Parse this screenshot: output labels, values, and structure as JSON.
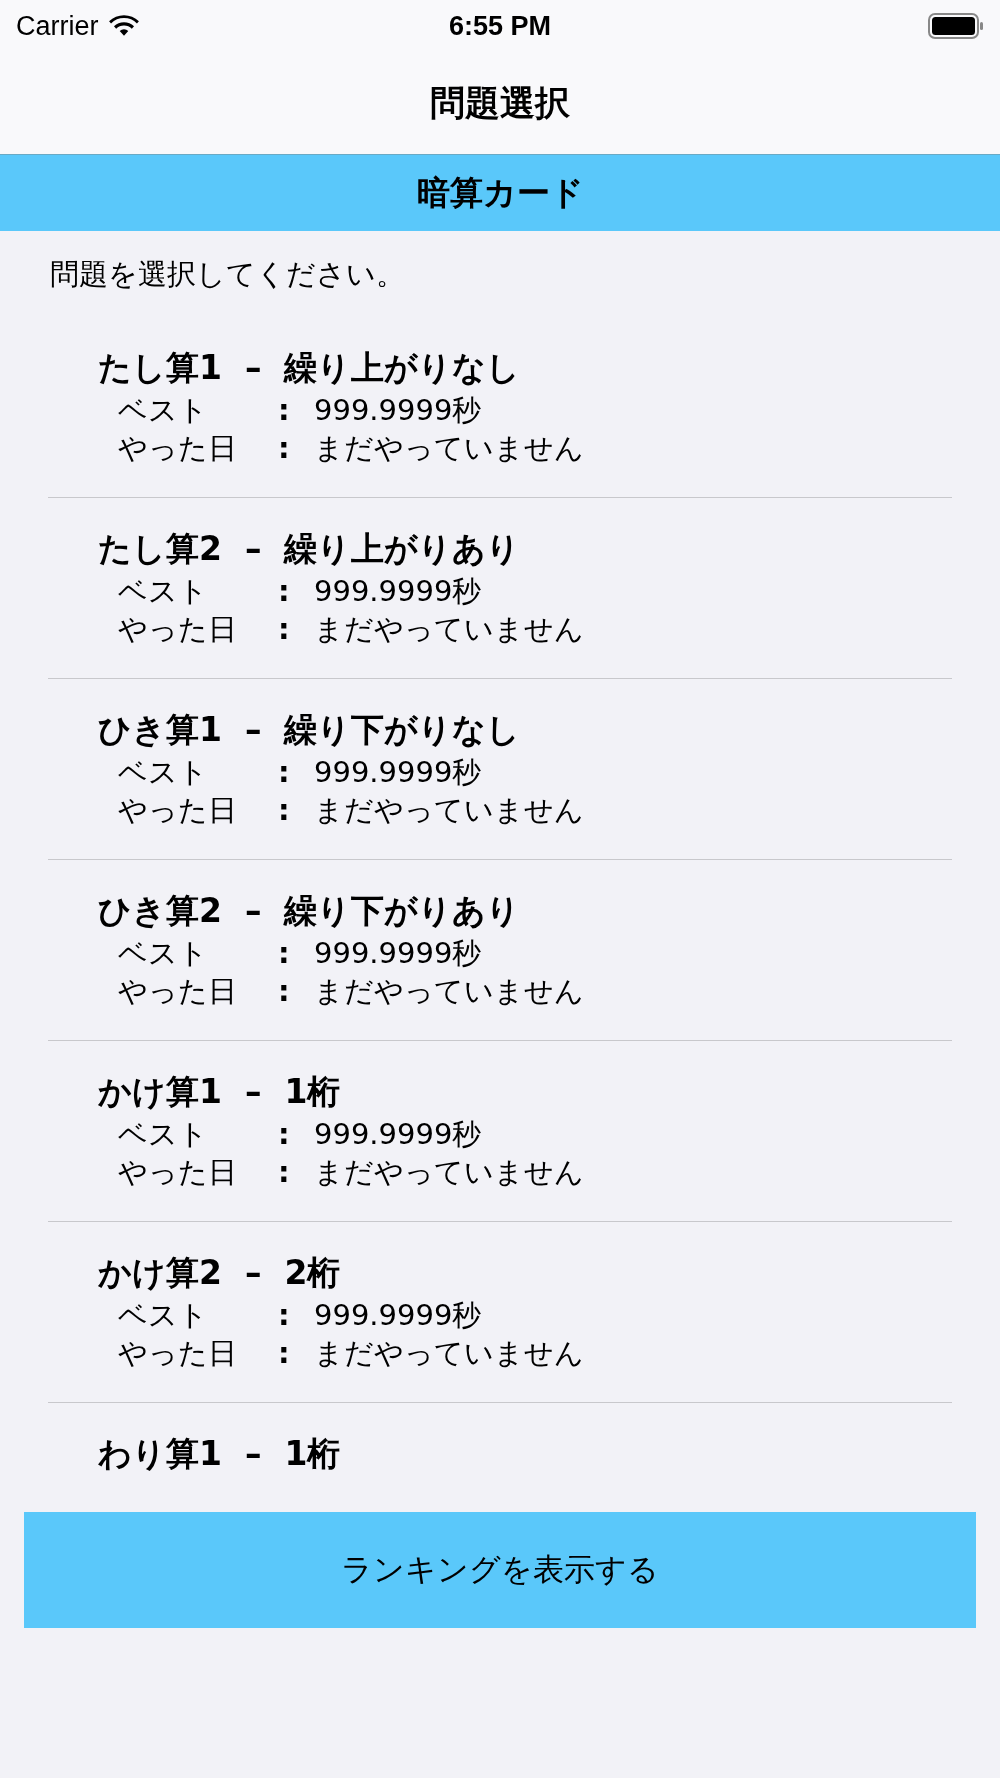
{
  "status_bar": {
    "carrier": "Carrier",
    "time": "6:55 PM"
  },
  "nav": {
    "title": "問題選択"
  },
  "header": {
    "title": "暗算カード"
  },
  "prompt": "問題を選択してください。",
  "problems": [
    {
      "title": "たし算1  –  繰り上がりなし",
      "best_label": "ベスト",
      "best_colon": ":",
      "best": "999.9999秒",
      "date_label": "やった日",
      "date_colon": ":",
      "date": "まだやっていません"
    },
    {
      "title": "たし算2  –  繰り上がりあり",
      "best_label": "ベスト",
      "best_colon": ":",
      "best": "999.9999秒",
      "date_label": "やった日",
      "date_colon": ":",
      "date": "まだやっていません"
    },
    {
      "title": "ひき算1  –  繰り下がりなし",
      "best_label": "ベスト",
      "best_colon": ":",
      "best": "999.9999秒",
      "date_label": "やった日",
      "date_colon": ":",
      "date": "まだやっていません"
    },
    {
      "title": "ひき算2  –  繰り下がりあり",
      "best_label": "ベスト",
      "best_colon": ":",
      "best": "999.9999秒",
      "date_label": "やった日",
      "date_colon": ":",
      "date": "まだやっていません"
    },
    {
      "title": "かけ算1  –  1桁",
      "best_label": "ベスト",
      "best_colon": ":",
      "best": "999.9999秒",
      "date_label": "やった日",
      "date_colon": ":",
      "date": "まだやっていません"
    },
    {
      "title": "かけ算2  –  2桁",
      "best_label": "ベスト",
      "best_colon": ":",
      "best": "999.9999秒",
      "date_label": "やった日",
      "date_colon": ":",
      "date": "まだやっていません"
    },
    {
      "title": "わり算1  –  1桁"
    }
  ],
  "button": "ランキングを表示する"
}
